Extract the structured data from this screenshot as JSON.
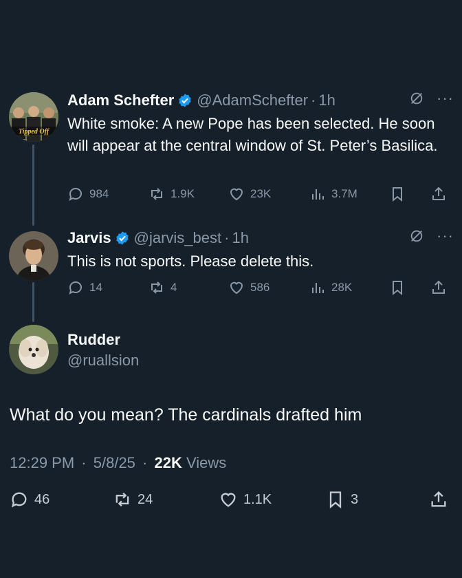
{
  "tweets": [
    {
      "name": "Adam Schefter",
      "handle": "@AdamSchefter",
      "time": "1h",
      "text": "White smoke: A new Pope has been selected. He soon will appear at the central window of St. Peter’s Basilica.",
      "replies": "984",
      "retweets": "1.9K",
      "likes": "23K",
      "views": "3.7M",
      "avatar_text": "Tipped Off"
    },
    {
      "name": "Jarvis",
      "handle": "@jarvis_best",
      "time": "1h",
      "text": "This is not sports.  Please delete this.",
      "replies": "14",
      "retweets": "4",
      "likes": "586",
      "views": "28K"
    }
  ],
  "main_tweet": {
    "name": "Rudder",
    "handle": "@ruallsion",
    "text": "What do you mean? The cardinals drafted him",
    "time": "12:29 PM",
    "date": "5/8/25",
    "views_count": "22K",
    "views_label": "Views",
    "replies": "46",
    "retweets": "24",
    "likes": "1.1K",
    "bookmarks": "3"
  },
  "colors": {
    "background": "#15202b",
    "verified": "#1d9bf0",
    "secondary_text": "#8b98a5"
  },
  "icons": [
    "verified-badge-icon",
    "grok-icon",
    "more-icon",
    "reply-icon",
    "retweet-icon",
    "like-icon",
    "views-icon",
    "bookmark-icon",
    "share-icon"
  ]
}
